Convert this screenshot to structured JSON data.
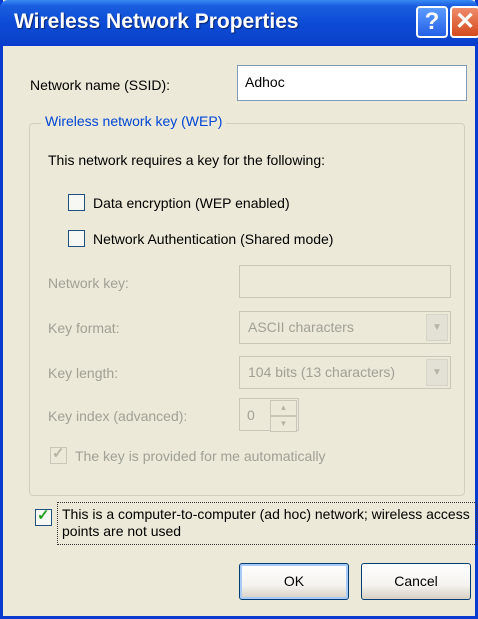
{
  "window": {
    "title": "Wireless Network Properties",
    "help_button": "?",
    "close_button": "✕"
  },
  "network_name": {
    "label": "Network name (SSID):",
    "value": "Adhoc"
  },
  "wep_group": {
    "legend": "Wireless network key (WEP)",
    "intro": "This network requires a key for the following:",
    "data_encryption": {
      "label": "Data encryption (WEP enabled)",
      "checked": false
    },
    "network_auth": {
      "label": "Network Authentication (Shared mode)",
      "checked": false
    },
    "network_key": {
      "label": "Network key:",
      "value": ""
    },
    "key_format": {
      "label": "Key format:",
      "value": "ASCII characters"
    },
    "key_length": {
      "label": "Key length:",
      "value": "104 bits (13 characters)"
    },
    "key_index": {
      "label": "Key index (advanced):",
      "value": "0"
    },
    "auto_key": {
      "label": "The key is provided for me automatically",
      "checked": true
    }
  },
  "adhoc": {
    "label": "This is a computer-to-computer (ad hoc) network; wireless access points are not used",
    "checked": true
  },
  "buttons": {
    "ok": "OK",
    "cancel": "Cancel"
  }
}
